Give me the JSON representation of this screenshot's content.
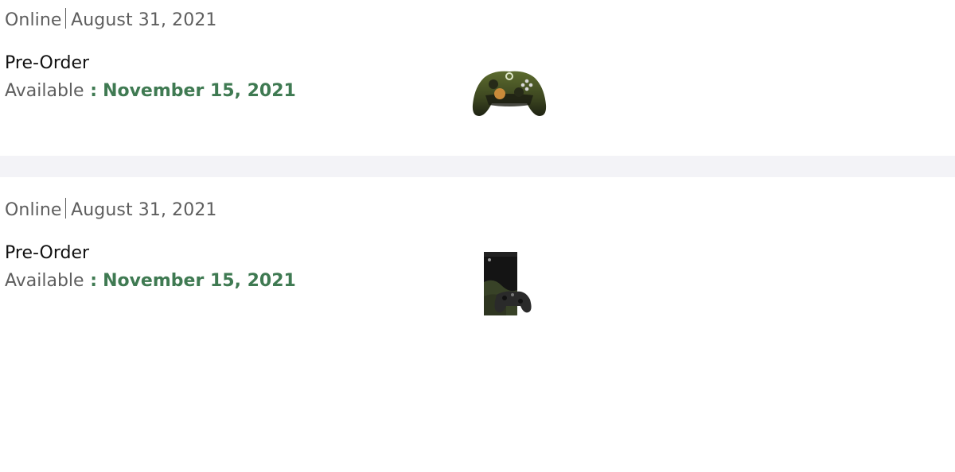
{
  "entries": [
    {
      "channel": "Online",
      "date": "August 31, 2021",
      "status": "Pre-Order",
      "available_label": "Available",
      "available_sep": " :",
      "available_date": "November 15, 2021",
      "image_icon": "controller-icon"
    },
    {
      "channel": "Online",
      "date": "August 31, 2021",
      "status": "Pre-Order",
      "available_label": "Available",
      "available_sep": " :",
      "available_date": "November 15, 2021",
      "image_icon": "console-icon"
    }
  ],
  "colors": {
    "accent_green": "#3f7a52",
    "text_gray": "#5e5e5e",
    "separator": "#f3f3f7"
  }
}
